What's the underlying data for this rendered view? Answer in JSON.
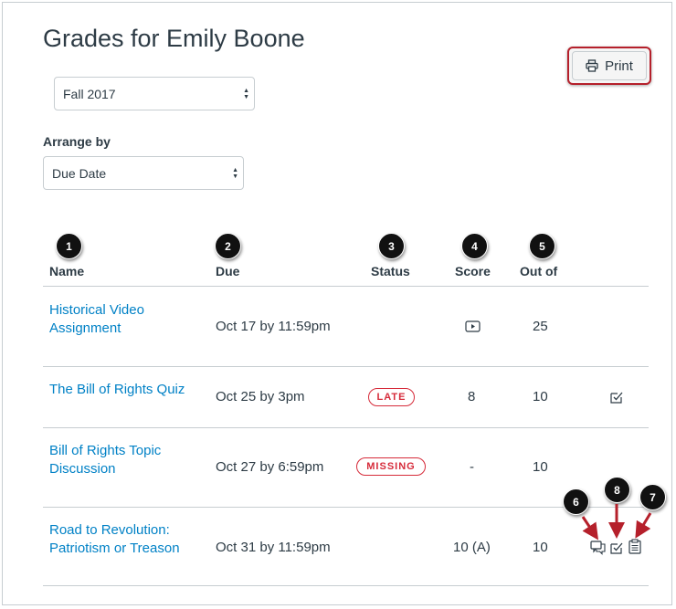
{
  "page": {
    "title": "Grades for Emily Boone"
  },
  "toolbar": {
    "print_label": "Print",
    "print_icon": "printer-icon"
  },
  "term_select": {
    "value": "Fall 2017"
  },
  "arrange": {
    "label": "Arrange by",
    "value": "Due Date"
  },
  "colors": {
    "link": "#0081c6",
    "text": "#2d3b45",
    "status": "#d62b3a",
    "annotation": "#b5202b"
  },
  "callouts": [
    "1",
    "2",
    "3",
    "4",
    "5",
    "6",
    "7",
    "8"
  ],
  "columns": {
    "name": "Name",
    "due": "Due",
    "status": "Status",
    "score": "Score",
    "out_of": "Out of"
  },
  "rows": [
    {
      "name_line1": "Historical Video",
      "name_line2": "Assignment",
      "due": "Oct 17 by 11:59pm",
      "status": "",
      "score": "",
      "score_icon": "media-icon",
      "out_of": "25"
    },
    {
      "name_line1": "The Bill of Rights Quiz",
      "name_line2": "",
      "due": "Oct 25 by 3pm",
      "status": "LATE",
      "score": "8",
      "out_of": "10",
      "icons": [
        "rubric-check-icon"
      ]
    },
    {
      "name_line1": "Bill of Rights Topic",
      "name_line2": "Discussion",
      "due": "Oct 27 by 6:59pm",
      "status": "MISSING",
      "score": "-",
      "out_of": "10"
    },
    {
      "name_line1": "Road to Revolution:",
      "name_line2": "Patriotism or Treason",
      "due": "Oct 31 by 11:59pm",
      "status": "",
      "score": "10 (A)",
      "out_of": "10",
      "icons": [
        "comments-icon",
        "rubric-check-icon",
        "clipboard-icon"
      ]
    }
  ]
}
